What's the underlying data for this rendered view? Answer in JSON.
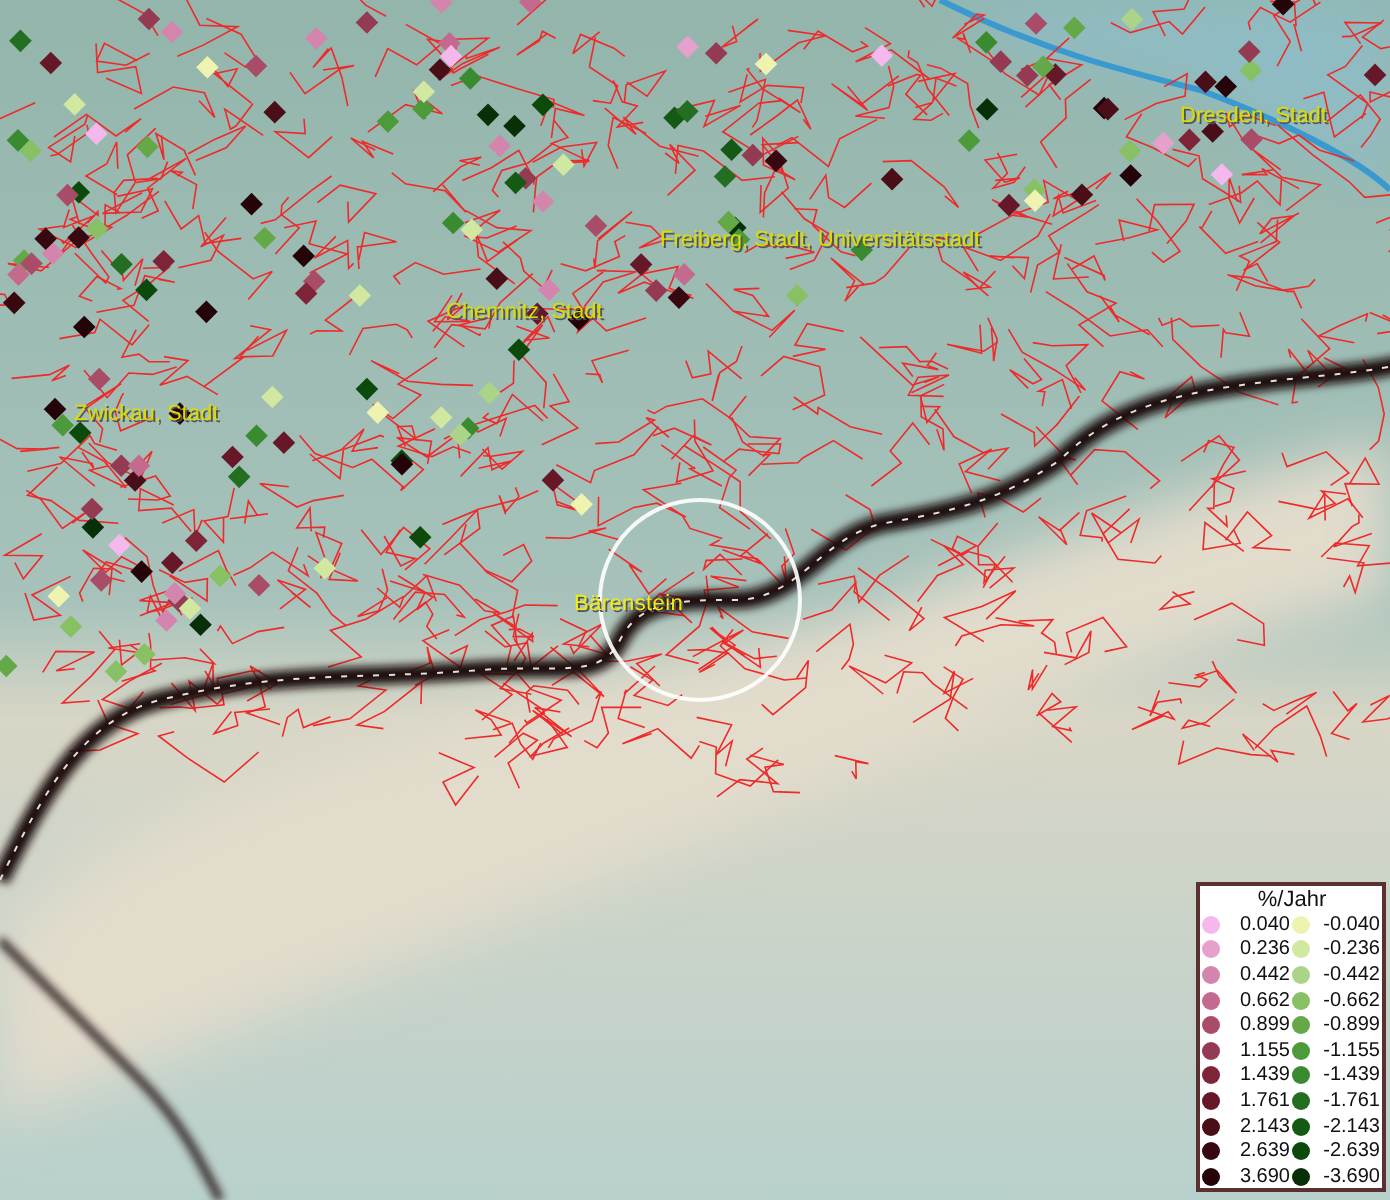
{
  "map": {
    "places": [
      {
        "kind": "city",
        "name": "Dresden, Stadt"
      },
      {
        "kind": "city",
        "name": "Freiberg, Stadt, Universitätsstadt"
      },
      {
        "kind": "city",
        "name": "Chemnitz, Stadt"
      },
      {
        "kind": "city",
        "name": "Zwickau, Stadt"
      },
      {
        "kind": "station",
        "name": "Bärenstein"
      }
    ]
  },
  "legend": {
    "title": "%/Jahr",
    "items": [
      {
        "label": "0.040",
        "color": "#f4b8ec"
      },
      {
        "label": "-0.040",
        "color": "#eef4b0"
      },
      {
        "label": "0.236",
        "color": "#e6a0cc"
      },
      {
        "label": "-0.236",
        "color": "#d0e8a0"
      },
      {
        "label": "0.442",
        "color": "#d485ae"
      },
      {
        "label": "-0.442",
        "color": "#acd488"
      },
      {
        "label": "0.662",
        "color": "#c46a8e"
      },
      {
        "label": "-0.662",
        "color": "#88c064"
      },
      {
        "label": "0.899",
        "color": "#a84c68"
      },
      {
        "label": "-0.899",
        "color": "#64a848"
      },
      {
        "label": "1.155",
        "color": "#943a52"
      },
      {
        "label": "-1.155",
        "color": "#4c9a3a"
      },
      {
        "label": "1.439",
        "color": "#7e2438"
      },
      {
        "label": "-1.439",
        "color": "#3a8a30"
      },
      {
        "label": "1.761",
        "color": "#661828"
      },
      {
        "label": "-1.761",
        "color": "#246e22"
      },
      {
        "label": "2.143",
        "color": "#4a0e18"
      },
      {
        "label": "-2.143",
        "color": "#145a14"
      },
      {
        "label": "2.639",
        "color": "#380810"
      },
      {
        "label": "-2.639",
        "color": "#0c4a0c"
      },
      {
        "label": "3.690",
        "color": "#240408"
      },
      {
        "label": "-3.690",
        "color": "#083008"
      }
    ]
  }
}
